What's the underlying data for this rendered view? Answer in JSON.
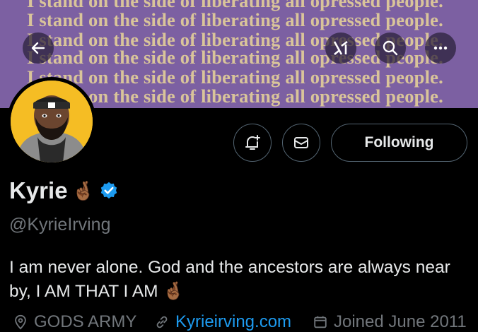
{
  "banner": {
    "text_lines": [
      "I stand on the side of liberating all opressed people.",
      "I stand on the side of liberating all opressed people.",
      "I stand on the side of liberating all opressed people.",
      "I stand on the side of liberating all opressed people.",
      "I stand on the side of liberating all opressed people.",
      "I stand on the side of liberating all opressed people."
    ]
  },
  "topbar": {
    "back_icon": "back-arrow-icon",
    "grok_icon": "grok-icon",
    "search_icon": "search-icon",
    "more_icon": "more-icon"
  },
  "actions": {
    "notify_icon": "bell-plus-icon",
    "message_icon": "envelope-icon",
    "follow_label": "Following"
  },
  "profile": {
    "name": "Kyrie",
    "name_emoji": "🤞🏾",
    "handle": "@KyrieIrving",
    "verified": true,
    "bio": "I am never alone. God and the ancestors are always near by, I AM THAT I AM 🤞🏾",
    "location": "GODS ARMY",
    "website": "Kyrieirving.com",
    "joined": "Joined June 2011"
  },
  "colors": {
    "banner_bg": "#7c60a2",
    "banner_text": "#d9c49a",
    "verified_badge": "#1d9bf0",
    "link": "#1d9bf0",
    "avatar_bg": "#f5bd24"
  }
}
